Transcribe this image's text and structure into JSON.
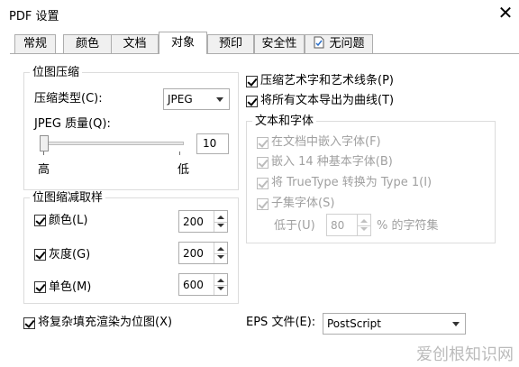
{
  "window": {
    "title": "PDF 设置",
    "close_symbol": "✕"
  },
  "tabs": [
    {
      "label": "常规",
      "active": false
    },
    {
      "label": "颜色",
      "active": false
    },
    {
      "label": "文档",
      "active": false
    },
    {
      "label": "对象",
      "active": true
    },
    {
      "label": "预印",
      "active": false
    },
    {
      "label": "安全性",
      "active": false
    },
    {
      "label": "无问题",
      "active": false,
      "icon": "document-check-icon"
    }
  ],
  "bitmap_compression": {
    "title": "位图压缩",
    "type_label": "压缩类型(C):",
    "type_value": "JPEG",
    "quality_label": "JPEG 质量(Q):",
    "quality_value": "10",
    "slider_fraction": 0.0,
    "high_label": "高",
    "low_label": "低"
  },
  "bitmap_downsampling": {
    "title": "位图缩减取样",
    "rows": [
      {
        "label": "颜色(L)",
        "checked": true,
        "value": "200"
      },
      {
        "label": "灰度(G)",
        "checked": true,
        "value": "200"
      },
      {
        "label": "单色(M)",
        "checked": true,
        "value": "600"
      }
    ]
  },
  "right_options": {
    "compress_art": {
      "label": "压缩艺术字和艺术线条(P)",
      "checked": true
    },
    "text_to_curves": {
      "label": "将所有文本导出为曲线(T)",
      "checked": true
    }
  },
  "text_fonts": {
    "title": "文本和字体",
    "embed": {
      "label": "在文档中嵌入字体(F)",
      "checked": true
    },
    "base14": {
      "label": "嵌入 14 种基本字体(B)",
      "checked": true
    },
    "truetype": {
      "label": "将 TrueType 转换为 Type 1(I)",
      "checked": true
    },
    "subset": {
      "label": "子集字体(S)",
      "checked": true
    },
    "below_label": "低于(U)",
    "below_value": "80",
    "below_suffix": "% 的字符集"
  },
  "complex_fill": {
    "label": "将复杂填充渲染为位图(X)",
    "checked": true
  },
  "eps": {
    "label": "EPS 文件(E):",
    "value": "PostScript"
  },
  "watermark": "爱创根知识网"
}
